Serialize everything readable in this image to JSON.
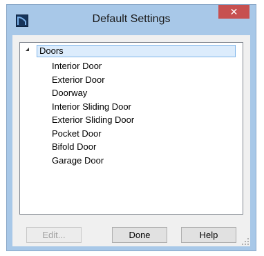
{
  "window": {
    "title": "Default Settings",
    "close_label": "✕"
  },
  "tree": {
    "root": {
      "label": "Doors",
      "expanded": true,
      "selected": true
    },
    "items": [
      {
        "label": "Interior Door"
      },
      {
        "label": "Exterior Door"
      },
      {
        "label": "Doorway"
      },
      {
        "label": "Interior Sliding Door"
      },
      {
        "label": "Exterior Sliding Door"
      },
      {
        "label": "Pocket Door"
      },
      {
        "label": "Bifold Door"
      },
      {
        "label": "Garage Door"
      }
    ]
  },
  "buttons": {
    "edit_label": "Edit...",
    "edit_enabled": false,
    "done_label": "Done",
    "help_label": "Help"
  },
  "colors": {
    "frame": "#a8c8e8",
    "close": "#c75050",
    "selection_bg": "#dcecfc",
    "selection_border": "#7eb4ea",
    "app_icon": "#16345a"
  }
}
